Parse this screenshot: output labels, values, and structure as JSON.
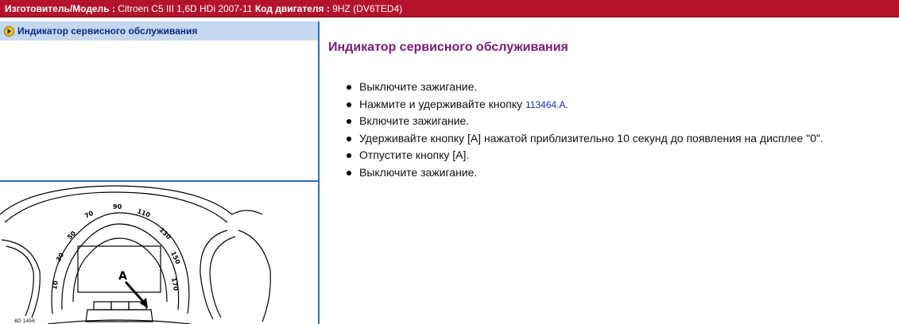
{
  "header": {
    "manufacturer_label": "Изготовитель/Модель :",
    "manufacturer_value": "Citroen C5 III 1,6D HDi 2007-11",
    "engine_label": "Код двигателя :",
    "engine_value": "9HZ (DV6TED4)"
  },
  "sidebar": {
    "items": [
      {
        "label": "Индикатор сервисного обслуживания"
      }
    ]
  },
  "diagram": {
    "callout": "A",
    "code": "AD 1456",
    "speed_ticks": [
      "10",
      "30",
      "50",
      "70",
      "90",
      "110",
      "130",
      "150",
      "170"
    ]
  },
  "main": {
    "title": "Индикатор сервисного обслуживания",
    "steps": [
      {
        "text": "Выключите зажигание."
      },
      {
        "text": "Нажмите и удерживайте кнопку ",
        "ref": "113464.A."
      },
      {
        "text": "Включите зажигание."
      },
      {
        "text": "Удерживайте кнопку [A] нажатой приблизительно 10 секунд до появления на дисплее \"0\"."
      },
      {
        "text": "Отпустите кнопку [A]."
      },
      {
        "text": "Выключите зажигание."
      }
    ]
  }
}
